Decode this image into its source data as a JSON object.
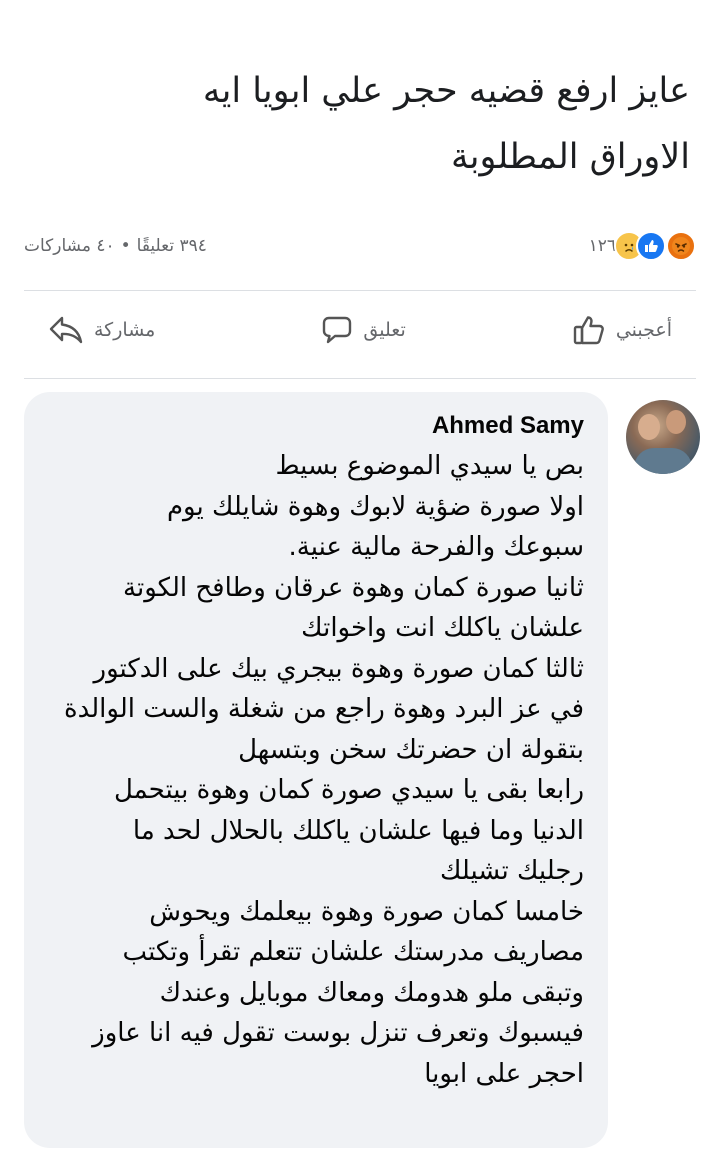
{
  "post": {
    "text_lines": [
      "عايز ارفع قضيه حجر علي ابويا ايه",
      "الاوراق المطلوبة"
    ]
  },
  "stats": {
    "reaction_count": "١٢٦",
    "comments": "٣٩٤ تعليقًا",
    "separator": "•",
    "shares": "٤٠ مشاركات",
    "reactions": [
      {
        "icon": "angry-reaction-icon",
        "color": "#e9710f"
      },
      {
        "icon": "like-reaction-icon",
        "color": "#1877f2"
      },
      {
        "icon": "sad-reaction-icon",
        "color": "#f7c44a"
      }
    ]
  },
  "actions": {
    "like_label": "أعجبني",
    "comment_label": "تعليق",
    "share_label": "مشاركة"
  },
  "comment": {
    "author": "Ahmed Samy",
    "lines": [
      "بص يا سيدي الموضوع بسيط",
      "اولا صورة ضؤية لابوك وهوة شايلك يوم",
      "سبوعك والفرحة مالية عنية.",
      "ثانيا صورة كمان وهوة عرقان وطافح الكوتة",
      "علشان ياكلك انت واخواتك",
      "ثالثا كمان صورة وهوة بيجري بيك على الدكتور",
      "في عز البرد وهوة راجع من شغلة والست الوالدة",
      "بتقولة ان حضرتك سخن وبتسهل",
      "رابعا بقى يا سيدي صورة كمان وهوة بيتحمل",
      "الدنيا وما فيها علشان ياكلك بالحلال لحد ما",
      "رجليك تشيلك",
      "خامسا كمان صورة وهوة بيعلمك ويحوش",
      "مصاريف مدرستك علشان تتعلم تقرأ وتكتب",
      "وتبقى ملو هدومك ومعاك موبايل وعندك",
      "فيسبوك وتعرف تنزل بوست تقول فيه انا عاوز",
      "احجر على ابويا"
    ]
  },
  "colors": {
    "text": "#1c1e21",
    "muted": "#65676b",
    "bubble": "#f0f2f5",
    "divider": "#dcdfe3"
  }
}
